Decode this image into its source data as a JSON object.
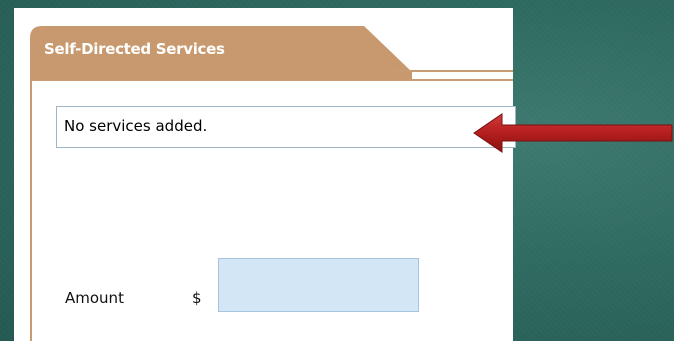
{
  "tab": {
    "title": "Self-Directed Services",
    "color": "#c8996e"
  },
  "services": {
    "list_text": "No services added."
  },
  "amount": {
    "label": "Amount",
    "currency_symbol": "$",
    "value": ""
  },
  "annotation": {
    "arrow_color": "#b41e1e",
    "arrow_direction": "left"
  },
  "colors": {
    "slide_background": "#2f6a61",
    "panel_border": "#c89c72",
    "input_fill": "#d3e6f5"
  }
}
